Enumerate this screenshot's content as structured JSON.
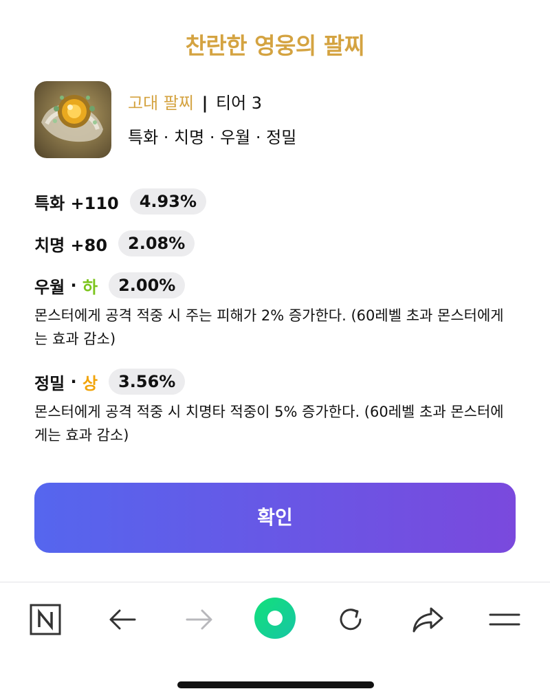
{
  "popup": {
    "title": "찬란한 영웅의 팔찌",
    "item": {
      "icon_name": "bracelet-item-icon",
      "name": "고대 팔찌",
      "separator": "|",
      "tier": "티어 3",
      "stat_summary": "특화 · 치명 · 우월 · 정밀"
    },
    "stats": [
      {
        "label": "특화 +110",
        "value": "4.93%"
      },
      {
        "label": "치명 +80",
        "value": "2.08%"
      }
    ],
    "effects": [
      {
        "name": "우월",
        "dot": " · ",
        "grade": "하",
        "grade_color": "#7bc41b",
        "value": "2.00%",
        "description": "몬스터에게 공격 적중 시 주는 피해가 2% 증가한다. (60레벨 초과 몬스터에게는 효과 감소)"
      },
      {
        "name": "정밀",
        "dot": " · ",
        "grade": "상",
        "grade_color": "#f1a40a",
        "value": "3.56%",
        "description": "몬스터에게 공격 적중 시 치명타 적중이 5% 증가한다. (60레벨 초과 몬스터에게는 효과 감소)"
      }
    ],
    "confirm_label": "확인"
  },
  "toolbar": {
    "items": [
      "naver-n-icon",
      "back-arrow-icon",
      "forward-arrow-icon",
      "green-dot-icon",
      "reload-icon",
      "share-icon",
      "menu-icon"
    ]
  },
  "colors": {
    "title_gold": "#d4a341",
    "button_gradient_start": "#5566ee",
    "button_gradient_end": "#7a49dd",
    "pill_bg": "#ececee",
    "green_accent": "#16d98a"
  }
}
